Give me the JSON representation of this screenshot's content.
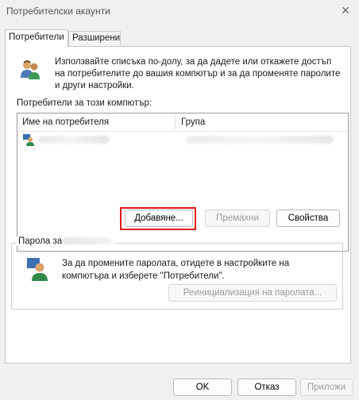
{
  "window": {
    "title": "Потребителски акаунти",
    "close_glyph": "×"
  },
  "tabs": [
    {
      "label": "Потребители",
      "active": true
    },
    {
      "label": "Разширени",
      "active": false
    }
  ],
  "intro": {
    "text": "Използвайте списъка по-долу, за да дадете или откажете достъп на потребителите до вашия компютър и за да променяте паролите и други настройки.",
    "icon": "users-icon"
  },
  "users": {
    "label": "Потребители за този компютър:",
    "columns": [
      "Име на потребителя",
      "Група"
    ],
    "rows": [
      {
        "icon": "user-icon"
      }
    ]
  },
  "buttons": {
    "add": "Добавяне...",
    "remove": "Премахни",
    "properties": "Свойства"
  },
  "password": {
    "legend": "Парола за",
    "text": "За да промените паролата, отидете в настройките на компютъра и изберете \"Потребители\".",
    "reset": "Реинициализация на паролата...",
    "icon": "password-user-icon"
  },
  "footer": {
    "ok": "OK",
    "cancel": "Отказ",
    "apply": "Приложи"
  },
  "colors": {
    "highlight": "#e0141c"
  }
}
